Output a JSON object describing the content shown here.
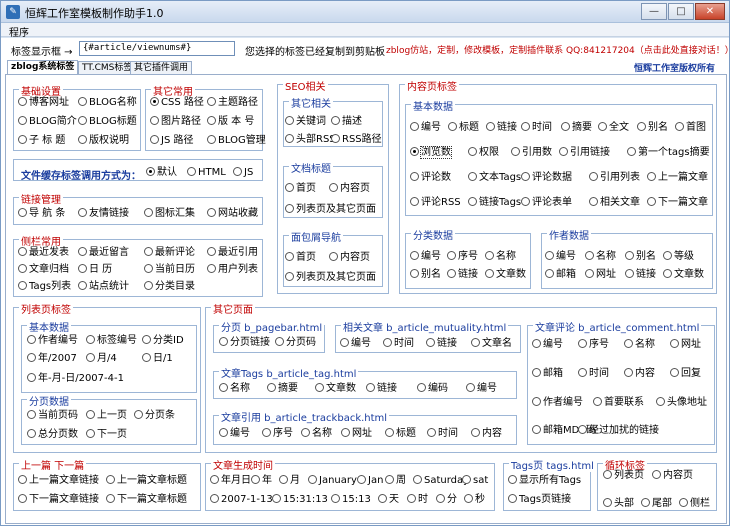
{
  "window": {
    "title": "恒辉工作室模板制作助手1.0",
    "min": "—",
    "max": "□",
    "close": "✕"
  },
  "menu": {
    "program": "程序"
  },
  "top": {
    "tag_label": "标签显示框 →",
    "tag_value": "{#article/viewnums#}",
    "copied_msg": "您选择的标签已经复制到剪贴板",
    "ad": "zblog仿站，定制，修改模板，定制插件联系 QQ:841217204（点击此处直接对话！）",
    "copyright": "恒辉工作室版权所有"
  },
  "tabs": [
    "zblog系统标签",
    "TT.CMS标签",
    "其它插件调用"
  ],
  "g_basic": {
    "title": "基础设置",
    "opts": [
      "博客网址",
      "BLOG名称",
      "BLOG简介",
      "BLOG标题",
      "子 标 题",
      "版权说明"
    ]
  },
  "g_other": {
    "title": "其它常用",
    "opts": [
      "CSS 路径",
      "主题路径",
      "图片路径",
      "版 本 号",
      "JS 路径",
      "BLOG管理"
    ]
  },
  "cache": {
    "label": "文件缓存标签调用方式为：",
    "opts": [
      "默认",
      "HTML",
      "JS"
    ]
  },
  "g_link": {
    "title": "链接管理",
    "opts": [
      "导 航 条",
      "友情链接",
      "图标汇集",
      "网站收藏"
    ]
  },
  "g_side": {
    "title": "侧栏常用",
    "opts": [
      "最近发表",
      "最近留言",
      "最新评论",
      "最近引用",
      "文章归档",
      "日  历",
      "当前日历",
      "用户列表",
      "Tags列表",
      "站点统计",
      "分类目录"
    ]
  },
  "seo": {
    "title": "SEO相关",
    "sub1": "其它相关",
    "opts1": [
      "关键词",
      "描述",
      "头部RSS",
      "RSS路径"
    ],
    "sub2": "文档标题",
    "opts2": [
      "首页",
      "内容页",
      "列表页及其它页面"
    ],
    "sub3": "面包屑导航",
    "opts3": [
      "首页",
      "内容页",
      "列表页及其它页面"
    ]
  },
  "content": {
    "title": "内容页标签",
    "basic_title": "基本数据",
    "basic": [
      "编号",
      "标题",
      "链接",
      "时间",
      "摘要",
      "全文",
      "别名",
      "首图",
      "浏览数",
      "权限",
      "引用数",
      "引用链接",
      "第一个tags摘要",
      "评论数",
      "文本Tags",
      "评论数据",
      "引用列表",
      "上一篇文章",
      "评论RSS",
      "链接Tags",
      "评论表单",
      "相关文章",
      "下一篇文章"
    ],
    "cat_title": "分类数据",
    "cat": [
      "编号",
      "序号",
      "名称",
      "别名",
      "链接",
      "文章数"
    ],
    "author_title": "作者数据",
    "author": [
      "编号",
      "名称",
      "别名",
      "等级",
      "邮箱",
      "网址",
      "链接",
      "文章数"
    ]
  },
  "listpage": {
    "title": "列表页标签",
    "sub1": "基本数据",
    "opts1": [
      "作者编号",
      "标签编号",
      "分类ID",
      "年/2007",
      "月/4",
      "日/1",
      "年-月-日/2007-4-1"
    ],
    "sub2": "分页数据",
    "opts2": [
      "当前页码",
      "上一页",
      "分页条",
      "总分页数",
      "下一页"
    ]
  },
  "otherpage": {
    "title": "其它页面",
    "pagebar": {
      "title": "分页 b_pagebar.html",
      "opts": [
        "分页链接",
        "分页码"
      ]
    },
    "mutual": {
      "title": "相关文章 b_article_mutuality.html",
      "opts": [
        "编号",
        "时间",
        "链接",
        "文章名"
      ]
    },
    "comment": {
      "title": "文章评论 b_article_comment.html",
      "opts": [
        "编号",
        "序号",
        "名称",
        "网址",
        "邮箱",
        "时间",
        "内容",
        "回复",
        "作者编号",
        "首要联系",
        "头像地址",
        "邮箱MD5码",
        "经过加扰的链接"
      ]
    },
    "tagtpl": {
      "title": "文章Tags b_article_tag.html",
      "opts": [
        "名称",
        "摘要",
        "文章数",
        "链接",
        "编码",
        "编号"
      ]
    },
    "track": {
      "title": "文章引用 b_article_trackback.html",
      "opts": [
        "编号",
        "序号",
        "名称",
        "网址",
        "标题",
        "时间",
        "内容"
      ]
    }
  },
  "prevnext": {
    "title": "上一篇 下一篇",
    "opts": [
      "上一篇文章链接",
      "上一篇文章标题",
      "下一篇文章链接",
      "下一篇文章标题"
    ]
  },
  "timegen": {
    "title": "文章生成时间",
    "opts": [
      "年月日",
      "年",
      "月",
      "January",
      "Jan",
      "周",
      "Saturday",
      "sat",
      "2007-1-13",
      "15:31:13",
      "15:13",
      "天",
      "时",
      "分",
      "秒"
    ]
  },
  "tagshtml": {
    "title": "Tags页 tags.html",
    "opts": [
      "显示所有Tags",
      "Tags页链接"
    ]
  },
  "loop": {
    "title": "循环标签",
    "opts": [
      "列表页",
      "内容页",
      "头部",
      "尾部",
      "侧栏"
    ]
  }
}
